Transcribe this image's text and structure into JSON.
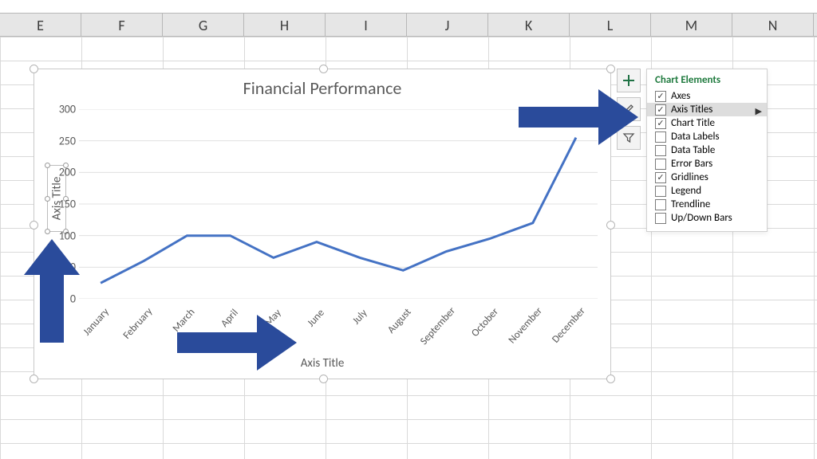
{
  "columns": [
    "E",
    "F",
    "G",
    "H",
    "I",
    "J",
    "K",
    "L",
    "M",
    "N"
  ],
  "chart": {
    "title": "Financial Performance",
    "x_axis_title": "Axis Title",
    "y_axis_title": "Axis Title",
    "y_ticks": [
      "0",
      "50",
      "100",
      "150",
      "200",
      "250",
      "300"
    ],
    "y_min": 0,
    "y_max": 300
  },
  "chart_data": {
    "type": "line",
    "title": "Financial Performance",
    "xlabel": "Axis Title",
    "ylabel": "Axis Title",
    "ylim": [
      0,
      300
    ],
    "categories": [
      "January",
      "February",
      "March",
      "April",
      "May",
      "June",
      "July",
      "August",
      "September",
      "October",
      "November",
      "December"
    ],
    "values": [
      25,
      60,
      100,
      100,
      65,
      90,
      65,
      45,
      75,
      95,
      120,
      255
    ]
  },
  "side_buttons": {
    "plus": "plus-icon",
    "brush": "paintbrush-icon",
    "filter": "funnel-icon"
  },
  "flyout": {
    "title": "Chart Elements",
    "items": [
      {
        "label": "Axes",
        "checked": true
      },
      {
        "label": "Axis Titles",
        "checked": true,
        "hover": true,
        "submenu": true
      },
      {
        "label": "Chart Title",
        "checked": true
      },
      {
        "label": "Data Labels",
        "checked": false
      },
      {
        "label": "Data Table",
        "checked": false
      },
      {
        "label": "Error Bars",
        "checked": false
      },
      {
        "label": "Gridlines",
        "checked": true
      },
      {
        "label": "Legend",
        "checked": false
      },
      {
        "label": "Trendline",
        "checked": false
      },
      {
        "label": "Up/Down Bars",
        "checked": false
      }
    ]
  }
}
